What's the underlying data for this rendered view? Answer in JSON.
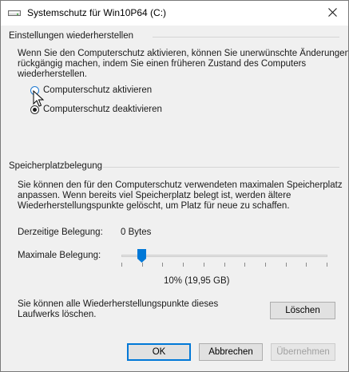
{
  "window": {
    "title": "Systemschutz für Win10P64 (C:)",
    "icon": "drive-icon",
    "close_icon": "close-icon"
  },
  "restore": {
    "heading": "Einstellungen wiederherstellen",
    "description": [
      "Wenn Sie den Computerschutz aktivieren, können Sie unerwünschte Änderungen",
      "rückgängig machen, indem Sie einen früheren Zustand des Computers",
      "wiederherstellen."
    ],
    "options": [
      {
        "label": "Computerschutz aktivieren",
        "checked": false
      },
      {
        "label": "Computerschutz deaktivieren",
        "checked": true
      }
    ]
  },
  "disk": {
    "heading": "Speicherplatzbelegung",
    "description": [
      "Sie können den für den Computerschutz verwendeten maximalen Speicherplatz",
      "anpassen. Wenn bereits viel Speicherplatz belegt ist, werden ältere",
      "Wiederherstellungspunkte gelöscht, um Platz für neue zu schaffen."
    ],
    "current_label": "Derzeitige Belegung:",
    "current_value": "0 Bytes",
    "max_label": "Maximale Belegung:",
    "slider_value_percent": 10,
    "slider_readout": "10% (19,95 GB)",
    "delete_text": [
      "Sie können alle Wiederherstellungspunkte dieses",
      "Laufwerks löschen."
    ],
    "delete_button": "Löschen"
  },
  "footer": {
    "ok": "OK",
    "cancel": "Abbrechen",
    "apply": "Übernehmen"
  },
  "colors": {
    "accent": "#0078d7",
    "slider_thumb": "#0078d7",
    "dialog_bg": "#f0f0f0"
  }
}
